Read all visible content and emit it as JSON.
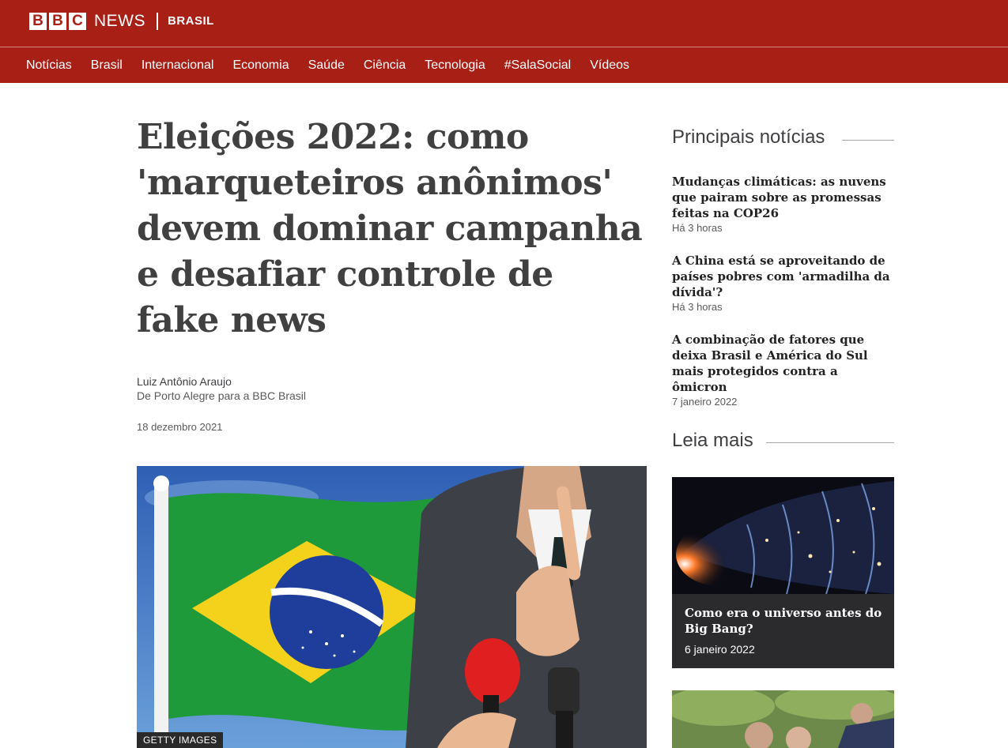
{
  "header": {
    "logo_letters": [
      "B",
      "B",
      "C"
    ],
    "logo_news": "NEWS",
    "logo_edition": "BRASIL",
    "brand_color": "#a81f16"
  },
  "nav": {
    "items": [
      "Notícias",
      "Brasil",
      "Internacional",
      "Economia",
      "Saúde",
      "Ciência",
      "Tecnologia",
      "#SalaSocial",
      "Vídeos"
    ]
  },
  "article": {
    "headline": "Eleições 2022: como 'marqueteiros anônimos' devem dominar campanha e desafiar controle de fake news",
    "author": "Luiz Antônio Araujo",
    "origin": "De Porto Alegre para a BBC Brasil",
    "date": "18 dezembro 2021",
    "image_credit": "GETTY IMAGES"
  },
  "sidebar": {
    "top_stories_title": "Principais notícias",
    "top_stories": [
      {
        "title": "Mudanças climáticas: as nuvens que pairam sobre as promessas feitas na COP26",
        "time": "Há 3 horas"
      },
      {
        "title": "A China está se aproveitando de países pobres com 'armadilha da dívida'?",
        "time": "Há 3 horas"
      },
      {
        "title": "A combinação de fatores que deixa Brasil e América do Sul mais protegidos contra a ômicron",
        "time": "7 janeiro 2022"
      }
    ],
    "read_more_title": "Leia mais",
    "read_more": [
      {
        "title": "Como era o universo antes do Big Bang?",
        "date": "6 janeiro 2022"
      }
    ]
  }
}
